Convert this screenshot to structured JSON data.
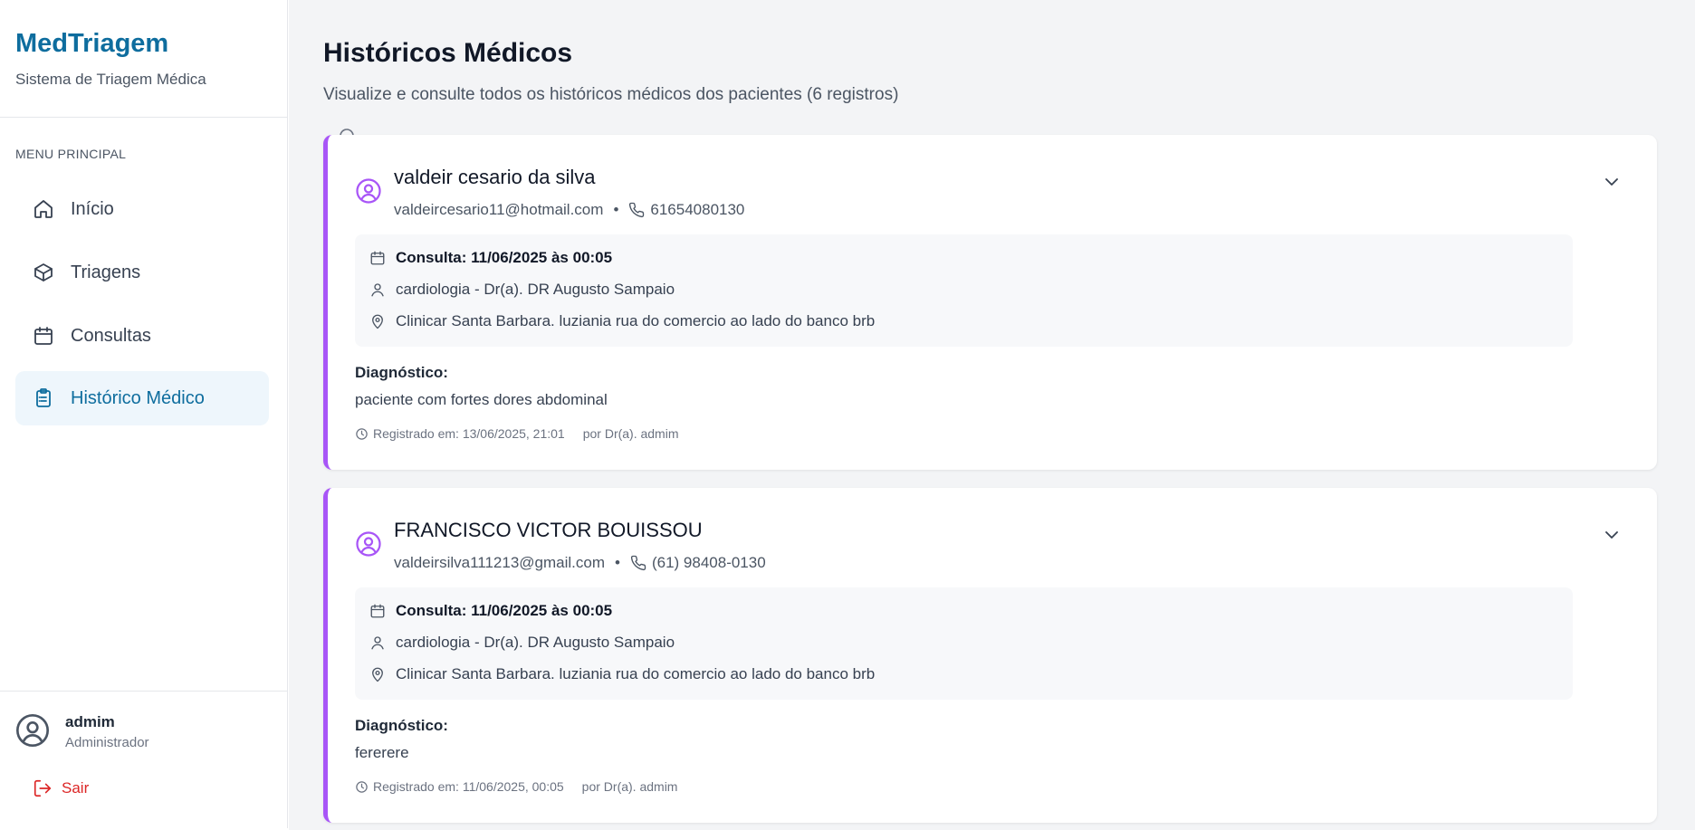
{
  "app": {
    "brand": "MedTriagem",
    "brand_subtitle": "Sistema de Triagem Médica"
  },
  "sidebar": {
    "menu_title": "MENU PRINCIPAL",
    "items": [
      {
        "label": "Início",
        "icon": "home-icon",
        "active": false
      },
      {
        "label": "Triagens",
        "icon": "box-icon",
        "active": false
      },
      {
        "label": "Consultas",
        "icon": "calendar-icon",
        "active": false
      },
      {
        "label": "Histórico Médico",
        "icon": "clipboard-list-icon",
        "active": true
      }
    ],
    "user": {
      "name": "admim",
      "role": "Administrador"
    },
    "logout_label": "Sair"
  },
  "page": {
    "title": "Históricos Médicos",
    "subtitle": "Visualize e consulte todos os históricos médicos dos pacientes (6 registros)"
  },
  "records": [
    {
      "patient_name": "valdeir cesario da silva",
      "email": "valdeircesario11@hotmail.com",
      "separator": "•",
      "phone": "61654080130",
      "consulta": "Consulta: 11/06/2025 às 00:05",
      "doctor": "cardiologia - Dr(a). DR Augusto Sampaio",
      "location": "Clinicar Santa Barbara. luziania rua do comercio ao lado do banco brb",
      "diagnosis_label": "Diagnóstico:",
      "diagnosis": "paciente com fortes dores abdominal",
      "registered": "Registrado em: 13/06/2025, 21:01",
      "registered_by": "por Dr(a). admim"
    },
    {
      "patient_name": "FRANCISCO VICTOR BOUISSOU",
      "email": "valdeirsilva111213@gmail.com",
      "separator": "•",
      "phone": "(61) 98408-0130",
      "consulta": "Consulta: 11/06/2025 às 00:05",
      "doctor": "cardiologia - Dr(a). DR Augusto Sampaio",
      "location": "Clinicar Santa Barbara. luziania rua do comercio ao lado do banco brb",
      "diagnosis_label": "Diagnóstico:",
      "diagnosis": "fererere",
      "registered": "Registrado em: 11/06/2025, 00:05",
      "registered_by": "por Dr(a). admim"
    }
  ],
  "colors": {
    "brand": "#0e6d9e",
    "accent_border": "#a855f7",
    "logout": "#dc2626",
    "active_bg": "#eef6fc"
  }
}
